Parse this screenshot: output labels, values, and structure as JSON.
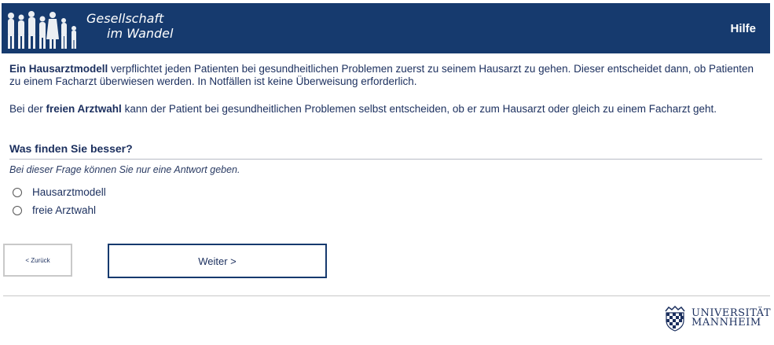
{
  "header": {
    "logo_line1": "Gesellschaft",
    "logo_line2": "im Wandel",
    "help_label": "Hilfe",
    "bg_color": "#163a6e"
  },
  "intro": {
    "p1_bold": "Ein Hausarztmodell",
    "p1_rest": " verpflichtet jeden Patienten bei gesundheitlichen Problemen zuerst zu seinem Hausarzt zu gehen. Dieser entscheidet dann, ob Patienten zu einem Facharzt überwiesen werden. In Notfällen ist keine Überweisung erforderlich.",
    "p2_pre": "Bei der ",
    "p2_bold": "freien Arztwahl",
    "p2_rest": " kann der Patient bei gesundheitlichen Problemen selbst entscheiden, ob er zum Hausarzt oder gleich zu einem Facharzt geht."
  },
  "question": {
    "title": "Was finden Sie besser?",
    "hint": "Bei dieser Frage können Sie nur eine Antwort geben.",
    "options": [
      "Hausarztmodell",
      "freie Arztwahl"
    ]
  },
  "nav": {
    "back_label": "< Zurück",
    "next_label": "Weiter >"
  },
  "footer": {
    "uni_line1": "UNIVERSITÄT",
    "uni_line2": "MANNHEIM"
  }
}
